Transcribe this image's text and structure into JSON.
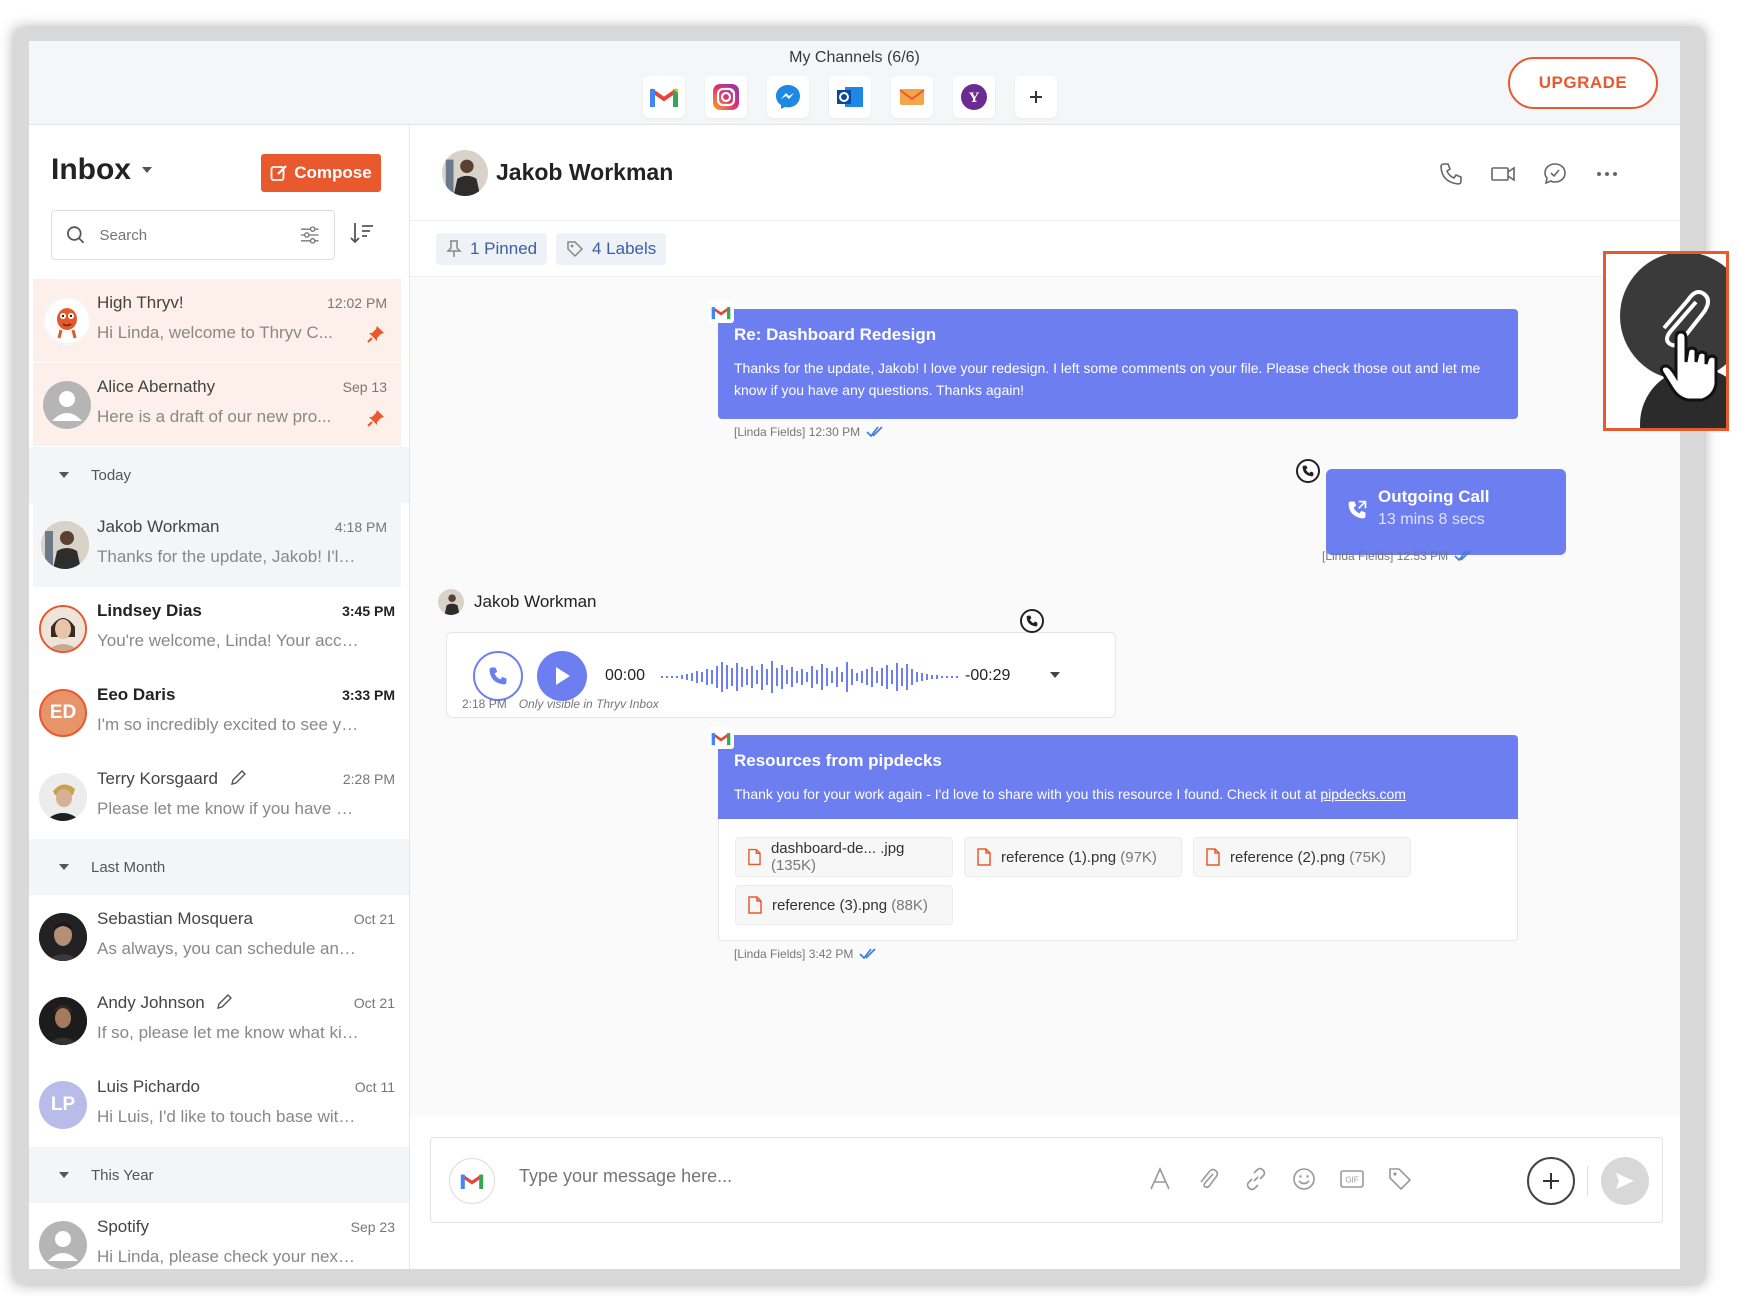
{
  "topbar": {
    "channels_title": "My Channels (6/6)",
    "channels": [
      "gmail-icon",
      "instagram-icon",
      "messenger-icon",
      "outlook-icon",
      "email-icon",
      "yahoo-icon",
      "plus-icon"
    ],
    "upgrade_label": "UPGRADE"
  },
  "sidebar": {
    "title": "Inbox",
    "compose_label": "Compose",
    "search_placeholder": "Search",
    "pinned": [
      {
        "name": "High Thryv!",
        "time": "12:02 PM",
        "preview": "Hi Linda, welcome to Thryv C..."
      },
      {
        "name": "Alice Abernathy",
        "time": "Sep 13",
        "preview": "Here is a draft of our new pro..."
      }
    ],
    "groups": {
      "today": "Today",
      "last_month": "Last Month",
      "this_year": "This Year"
    },
    "today": [
      {
        "name": "Jakob Workman",
        "time": "4:18 PM",
        "preview": "Thanks for the update, Jakob! I'll let ..."
      },
      {
        "name": "Lindsey Dias",
        "time": "3:45 PM",
        "preview": "You're welcome, Linda! Your accou..."
      },
      {
        "name": "Eeo Daris",
        "initials": "ED",
        "time": "3:33 PM",
        "preview": "I'm so incredibly excited to see you ..."
      },
      {
        "name": "Terry Korsgaard",
        "time": "2:28 PM",
        "preview": "Please let me know if you have any ..."
      }
    ],
    "last_month": [
      {
        "name": "Sebastian Mosquera",
        "time": "Oct 21",
        "preview": "As always, you can schedule an app..."
      },
      {
        "name": "Andy Johnson",
        "time": "Oct 21",
        "preview": "If so, please let me know what kind ..."
      },
      {
        "name": "Luis Pichardo",
        "initials": "LP",
        "time": "Oct 11",
        "preview": "Hi Luis, I'd like to touch base with y..."
      }
    ],
    "this_year": [
      {
        "name": "Spotify",
        "time": "Sep 23",
        "preview": "Hi Linda, please check your next m..."
      }
    ]
  },
  "chat": {
    "contact": "Jakob Workman",
    "pinned_label": "1 Pinned",
    "labels_label": "4 Labels",
    "email1": {
      "subject": "Re: Dashboard Redesign",
      "body": "Thanks for the update, Jakob! I love your redesign. I left some comments on your file. Please check those out and let me know if you have any questions. Thanks again!",
      "meta": "[Linda Fields] 12:30 PM"
    },
    "call": {
      "title": "Outgoing Call",
      "duration": "13 mins 8 secs",
      "meta": "[Linda Fields] 12:53 PM"
    },
    "voice": {
      "sender": "Jakob Workman",
      "elapsed": "00:00",
      "remaining": "-00:29",
      "time": "2:18 PM",
      "note": "Only visible in Thryv Inbox"
    },
    "email2": {
      "subject": "Resources from pipdecks",
      "body": "Thank you for your work again - I'd love to share with you this resource I found. Check it out at",
      "link": "pipdecks.com",
      "meta": "[Linda Fields] 3:42 PM",
      "files": [
        {
          "name": "dashboard-de... .jpg",
          "size": "(135K)"
        },
        {
          "name": "reference (1).png",
          "size": "(97K)"
        },
        {
          "name": "reference (2).png",
          "size": "(75K)"
        },
        {
          "name": "reference (3).png",
          "size": "(88K)"
        }
      ]
    },
    "composer_placeholder": "Type your message here..."
  },
  "colors": {
    "accent": "#e8592d",
    "bubble": "#6c7ef0",
    "link": "#3b5ea8"
  }
}
